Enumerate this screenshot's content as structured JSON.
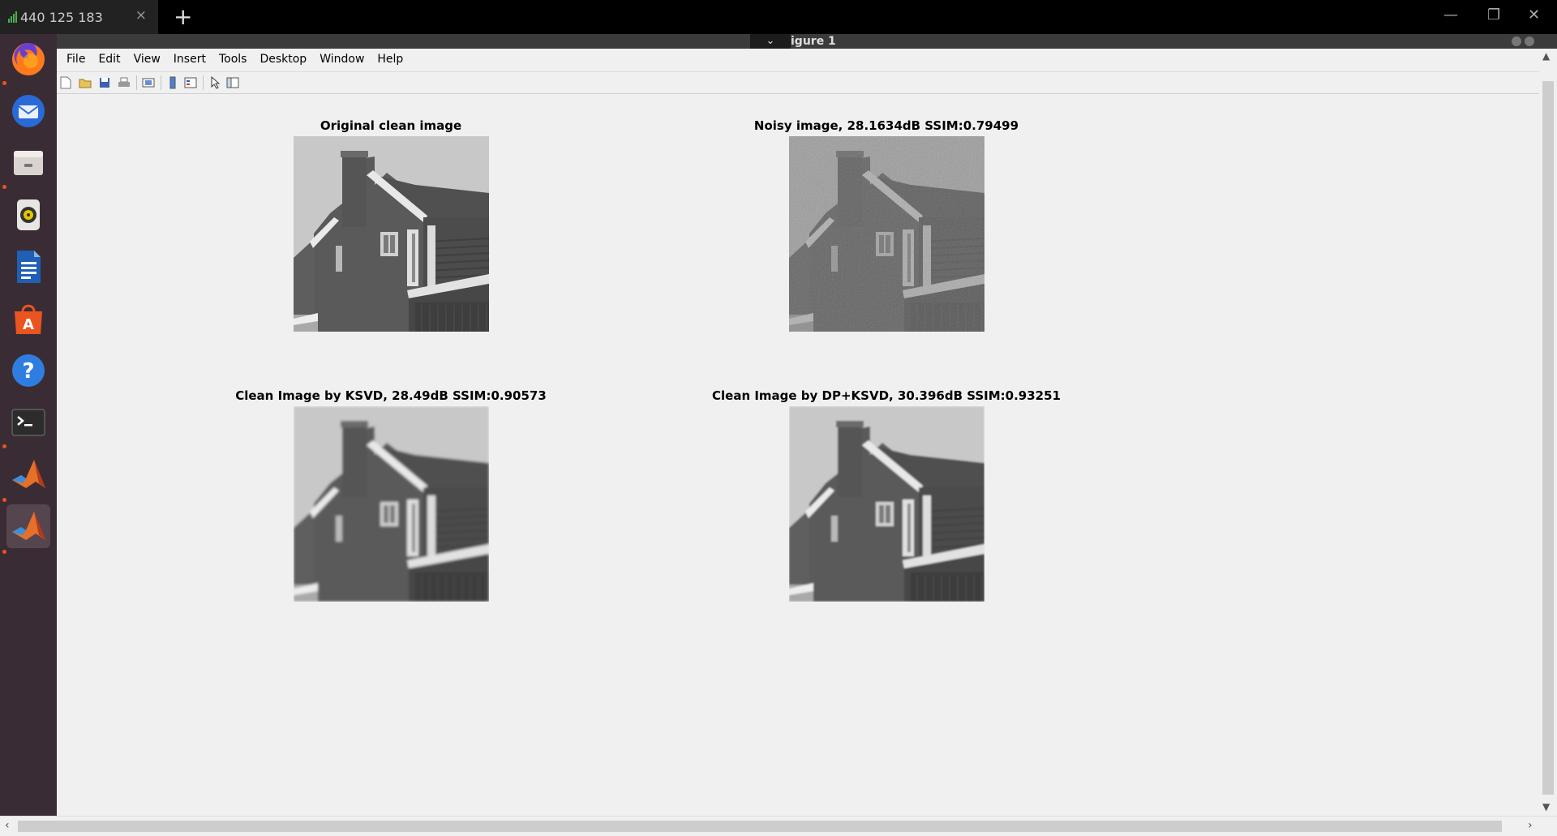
{
  "tabbar": {
    "tab_label": "440 125 183",
    "close_glyph": "×",
    "new_tab_glyph": "+",
    "win_min": "—",
    "win_restore": "❐",
    "win_close": "✕"
  },
  "dock": {
    "items": [
      {
        "name": "firefox-icon"
      },
      {
        "name": "thunderbird-icon"
      },
      {
        "name": "files-icon"
      },
      {
        "name": "rhythmbox-icon"
      },
      {
        "name": "libreoffice-writer-icon"
      },
      {
        "name": "ubuntu-software-icon"
      },
      {
        "name": "help-icon"
      },
      {
        "name": "terminal-icon"
      },
      {
        "name": "matlab-icon"
      },
      {
        "name": "matlab-active-icon"
      }
    ]
  },
  "figure": {
    "title": "igure 1",
    "chevron": "⌄",
    "menus": [
      "File",
      "Edit",
      "View",
      "Insert",
      "Tools",
      "Desktop",
      "Window",
      "Help"
    ],
    "toolbar_icons": [
      "new-figure-icon",
      "open-file-icon",
      "save-icon",
      "print-icon",
      "link-plot-icon",
      "insert-colorbar-icon",
      "insert-legend-icon",
      "edit-plot-icon",
      "property-inspector-icon"
    ]
  },
  "subplots": [
    {
      "title": "Original clean image",
      "noise": 0,
      "blur": 0
    },
    {
      "title": "Noisy image, 28.1634dB SSIM:0.79499",
      "noise": 1,
      "blur": 0
    },
    {
      "title": "Clean Image by KSVD, 28.49dB SSIM:0.90573",
      "noise": 0,
      "blur": 1
    },
    {
      "title": "Clean Image by DP+KSVD, 30.396dB SSIM:0.93251",
      "noise": 0,
      "blur": 0.6
    }
  ],
  "scroll": {
    "up": "▲",
    "down": "▼",
    "left": "‹",
    "right": "›"
  },
  "colors": {
    "dock_bg": "#3a2c34",
    "accent": "#e95420",
    "figure_bg": "#f0f0f0"
  }
}
